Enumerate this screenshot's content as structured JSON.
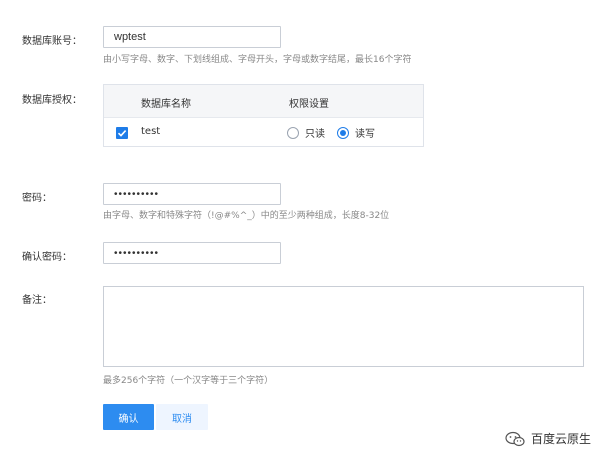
{
  "form": {
    "account": {
      "label": "数据库账号：",
      "value": "wptest",
      "hint": "由小写字母、数字、下划线组成、字母开头，字母或数字结尾，最长16个字符"
    },
    "authorization": {
      "label": "数据库授权：",
      "col_name": "数据库名称",
      "col_perm": "权限设置",
      "rows": [
        {
          "checked": true,
          "name": "test",
          "option_readonly": "只读",
          "option_readwrite": "读写",
          "selected": "读写"
        }
      ]
    },
    "password": {
      "label": "密码：",
      "value": "••••••••••",
      "hint": "由字母、数字和特殊字符（!@#%^_）中的至少两种组成，长度8-32位"
    },
    "confirm_password": {
      "label": "确认密码：",
      "value": "••••••••••"
    },
    "note": {
      "label": "备注：",
      "value": "",
      "hint": "最多256个字符（一个汉字等于三个字符）"
    }
  },
  "buttons": {
    "confirm": "确认",
    "cancel": "取消"
  },
  "watermark": {
    "text": "百度云原生",
    "icon": "wechat-icon"
  },
  "colors": {
    "primary": "#2d8cf0",
    "checkbox": "#1e7ce8",
    "border": "#c9ced6",
    "hint": "#888888"
  }
}
